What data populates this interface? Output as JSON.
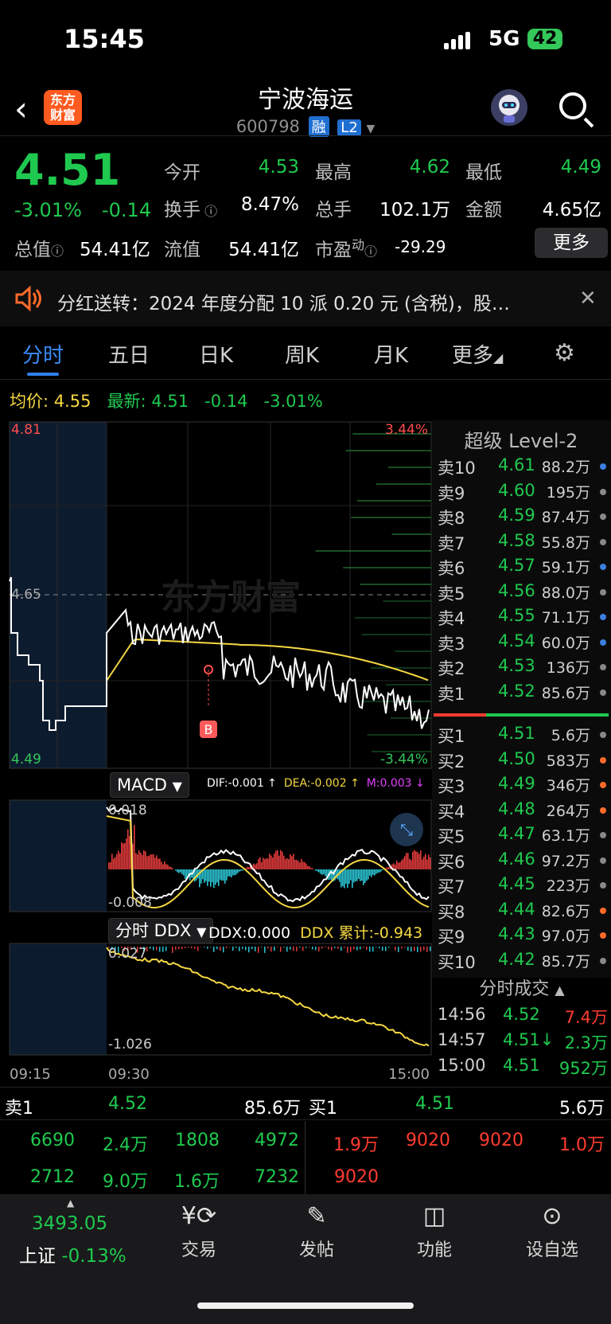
{
  "status": {
    "time": "15:45",
    "network": "5G",
    "battery": "42"
  },
  "header": {
    "title": "宁波海运",
    "code": "600798",
    "badge_margin": "融",
    "badge_level": "L2",
    "logo_line1": "东方",
    "logo_line2": "财富"
  },
  "quote": {
    "price": "4.51",
    "pct": "-3.01%",
    "chg": "-0.14",
    "open_label": "今开",
    "open": "4.53",
    "high_label": "最高",
    "high": "4.62",
    "low_label": "最低",
    "low": "4.49",
    "turnover_label": "换手",
    "turnover": "8.47%",
    "volume_label": "总手",
    "volume": "102.1万",
    "amount_label": "金额",
    "amount": "4.65亿",
    "mcap_label": "总值",
    "mcap": "54.41亿",
    "float_label": "流值",
    "float": "54.41亿",
    "pe_label": "市盈",
    "pe_sup": "动",
    "pe": "-29.29",
    "more": "更多"
  },
  "notice": {
    "text": "分红送转：2024 年度分配 10 派 0.20 元 (含税)，股…"
  },
  "tabs": [
    "分时",
    "五日",
    "日K",
    "周K",
    "月K",
    "更多"
  ],
  "infobar": {
    "avg_label": "均价:",
    "avg": "4.55",
    "latest_label": "最新:",
    "latest": "4.51",
    "chg": "-0.14",
    "pct": "-3.01%"
  },
  "chart": {
    "price_top": "4.81",
    "price_mid": "4.65",
    "price_bottom": "4.49",
    "pct_top": "3.44%",
    "pct_bottom": "-3.44%",
    "buy_marker": "B",
    "watermark": "东方财富",
    "macd_btn": "MACD",
    "dif": "DIF:-0.001 ↑",
    "dea": "DEA:-0.002 ↑",
    "m": "M:0.003 ↓",
    "macd_top": "0.018",
    "macd_bottom": "-0.008",
    "ddx_btn": "分时 DDX",
    "ddx": "DDX:0.000",
    "ddx_cum": "DDX 累计:-0.943",
    "ddx_top": "0.027",
    "ddx_bottom": "-1.026",
    "time_start": "09:15",
    "time_open": "09:30",
    "time_end": "15:00"
  },
  "level2": {
    "title": "超级 Level-2",
    "asks": [
      {
        "n": "卖10",
        "p": "4.61",
        "v": "88.2万",
        "dot": "#3d7fe0"
      },
      {
        "n": "卖9",
        "p": "4.60",
        "v": "195万",
        "dot": "#888"
      },
      {
        "n": "卖8",
        "p": "4.59",
        "v": "87.4万",
        "dot": "#888"
      },
      {
        "n": "卖7",
        "p": "4.58",
        "v": "55.8万",
        "dot": "#888"
      },
      {
        "n": "卖6",
        "p": "4.57",
        "v": "59.1万",
        "dot": "#3d7fe0"
      },
      {
        "n": "卖5",
        "p": "4.56",
        "v": "88.0万",
        "dot": "#888"
      },
      {
        "n": "卖4",
        "p": "4.55",
        "v": "71.1万",
        "dot": "#3d7fe0"
      },
      {
        "n": "卖3",
        "p": "4.54",
        "v": "60.0万",
        "dot": "#3d7fe0"
      },
      {
        "n": "卖2",
        "p": "4.53",
        "v": "136万",
        "dot": "#888"
      },
      {
        "n": "卖1",
        "p": "4.52",
        "v": "85.6万",
        "dot": "#888"
      }
    ],
    "bids": [
      {
        "n": "买1",
        "p": "4.51",
        "v": "5.6万",
        "dot": "#888"
      },
      {
        "n": "买2",
        "p": "4.50",
        "v": "583万",
        "dot": "#ff6a2b"
      },
      {
        "n": "买3",
        "p": "4.49",
        "v": "346万",
        "dot": "#ff6a2b"
      },
      {
        "n": "买4",
        "p": "4.48",
        "v": "264万",
        "dot": "#ff6a2b"
      },
      {
        "n": "买5",
        "p": "4.47",
        "v": "63.1万",
        "dot": "#888"
      },
      {
        "n": "买6",
        "p": "4.46",
        "v": "97.2万",
        "dot": "#888"
      },
      {
        "n": "买7",
        "p": "4.45",
        "v": "223万",
        "dot": "#888"
      },
      {
        "n": "买8",
        "p": "4.44",
        "v": "82.6万",
        "dot": "#ff6a2b"
      },
      {
        "n": "买9",
        "p": "4.43",
        "v": "97.0万",
        "dot": "#ff6a2b"
      },
      {
        "n": "买10",
        "p": "4.42",
        "v": "85.7万",
        "dot": "#888"
      }
    ]
  },
  "ticks": {
    "title": "分时成交",
    "rows": [
      {
        "t": "14:56",
        "p": "4.52",
        "v": "7.4万",
        "vc": "red"
      },
      {
        "t": "14:57",
        "p": "4.51↓",
        "v": "2.3万",
        "vc": "green"
      },
      {
        "t": "15:00",
        "p": "4.51",
        "v": "952万",
        "vc": "green"
      }
    ]
  },
  "bottom_quote": {
    "ask_label": "卖1",
    "ask_price": "4.52",
    "ask_vol": "85.6万",
    "bid_label": "买1",
    "bid_price": "4.51",
    "bid_vol": "5.6万",
    "ask_queue": [
      "6690",
      "2.4万",
      "1808",
      "4972",
      "2712",
      "9.0万",
      "1.6万",
      "7232"
    ],
    "bid_queue": [
      "1.9万",
      "9020",
      "9020",
      "1.0万",
      "9020"
    ]
  },
  "nav": {
    "index_value": "3493.05",
    "index_name": "上证",
    "index_pct": "-0.13%",
    "trade": "交易",
    "post": "发帖",
    "func": "功能",
    "watch": "设自选"
  },
  "chart_data": {
    "type": "line",
    "series": [
      {
        "name": "均价",
        "color": "#f5d742"
      },
      {
        "name": "最新",
        "color": "#ffffff"
      }
    ],
    "ylim": [
      4.49,
      4.81
    ],
    "x": [
      "09:15",
      "09:30",
      "15:00"
    ]
  }
}
